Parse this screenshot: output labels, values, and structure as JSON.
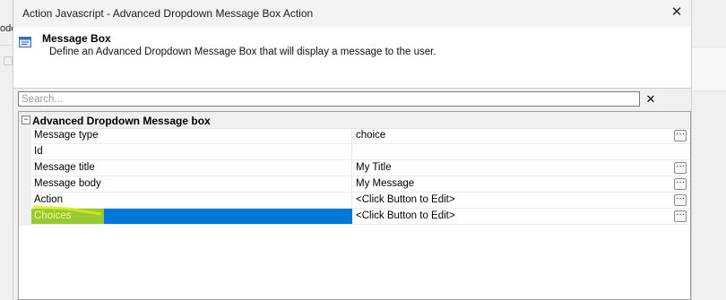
{
  "background_app": {
    "left_fragment": "ode"
  },
  "dialog": {
    "title": "Action Javascript - Advanced Dropdown Message Box Action",
    "header": {
      "title": "Message Box",
      "description": "Define an Advanced Dropdown Message Box that will display a message to the user."
    },
    "search": {
      "placeholder": "Search...",
      "value": "",
      "clear_glyph": "✕"
    },
    "grid": {
      "category": {
        "toggle_glyph": "−",
        "title": "Advanced Dropdown Message box"
      },
      "rows": [
        {
          "name": "Message type",
          "value": "choice",
          "button": "···"
        },
        {
          "name": "Id",
          "value": ""
        },
        {
          "name": "Message title",
          "value": "My Title",
          "button": "···"
        },
        {
          "name": "Message body",
          "value": "My Message",
          "button": "···"
        },
        {
          "name": "Action",
          "value": "<Click Button to Edit>",
          "button": "···"
        },
        {
          "name": "Choices",
          "value": "<Click Button to Edit>",
          "button": "···",
          "selected": true
        }
      ]
    },
    "close_glyph": "✕"
  },
  "colors": {
    "selection": "#0078d7",
    "highlighter": "#c9e400"
  },
  "icons": {
    "header_icon": "message-box-icon",
    "close": "close-icon",
    "clear": "clear-search-icon"
  }
}
